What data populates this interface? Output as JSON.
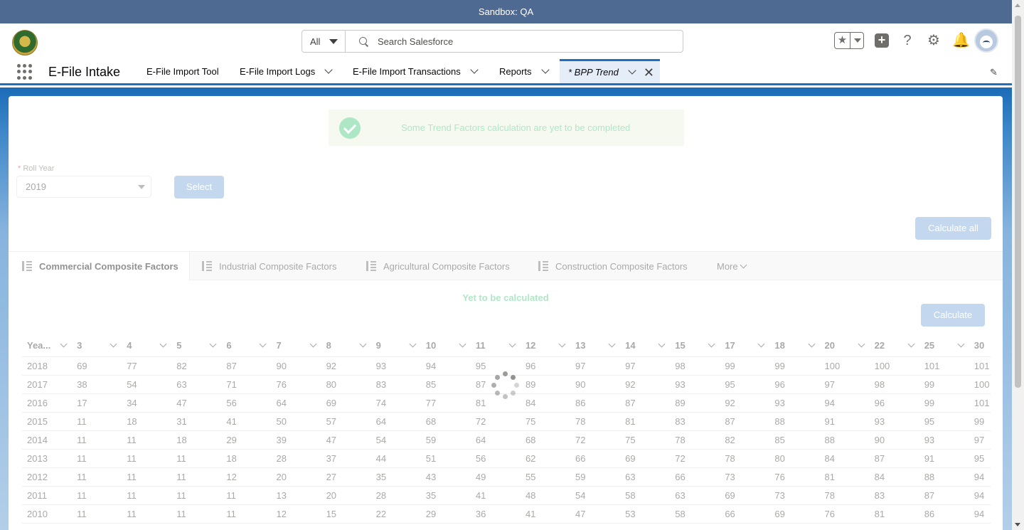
{
  "sandbox": {
    "label": "Sandbox: QA"
  },
  "header": {
    "search_scope": "All",
    "search_placeholder": "Search Salesforce",
    "icons": [
      "favorites-star-icon",
      "add-plus-icon",
      "help-question-icon",
      "setup-gear-icon",
      "notification-bell-icon",
      "user-avatar"
    ]
  },
  "nav": {
    "app_name": "E-File Intake",
    "items": [
      {
        "label": "E-File Import Tool"
      },
      {
        "label": "E-File Import Logs"
      },
      {
        "label": "E-File Import Transactions"
      },
      {
        "label": "Reports"
      }
    ],
    "active_tab": "* BPP Trend"
  },
  "toast": {
    "message": "Some Trend Factors calculation are yet to be completed"
  },
  "form": {
    "roll_year_label": "Roll Year",
    "roll_year_required": "*",
    "roll_year_value": "2019",
    "select_button": "Select",
    "calculate_all_button": "Calculate all"
  },
  "tabs": [
    {
      "label": "Commercial Composite Factors"
    },
    {
      "label": "Industrial Composite Factors"
    },
    {
      "label": "Agricultural Composite Factors"
    },
    {
      "label": "Construction Composite Factors"
    }
  ],
  "more_tab": "More",
  "status_text": "Yet to be calculated",
  "calculate_button": "Calculate",
  "table": {
    "columns": [
      "Yea...",
      "3",
      "4",
      "5",
      "6",
      "7",
      "8",
      "9",
      "10",
      "11",
      "12",
      "13",
      "14",
      "15",
      "17",
      "18",
      "20",
      "22",
      "25",
      "30"
    ],
    "rows": [
      [
        "2018",
        "69",
        "77",
        "82",
        "87",
        "90",
        "92",
        "93",
        "94",
        "95",
        "96",
        "97",
        "97",
        "98",
        "99",
        "99",
        "100",
        "100",
        "101",
        "101"
      ],
      [
        "2017",
        "38",
        "54",
        "63",
        "71",
        "76",
        "80",
        "83",
        "85",
        "87",
        "89",
        "90",
        "92",
        "93",
        "95",
        "96",
        "97",
        "98",
        "99",
        "100"
      ],
      [
        "2016",
        "17",
        "34",
        "47",
        "56",
        "64",
        "69",
        "74",
        "77",
        "81",
        "84",
        "86",
        "87",
        "89",
        "92",
        "93",
        "94",
        "96",
        "99",
        "101"
      ],
      [
        "2015",
        "11",
        "18",
        "31",
        "41",
        "50",
        "57",
        "64",
        "68",
        "72",
        "75",
        "78",
        "81",
        "83",
        "87",
        "88",
        "91",
        "93",
        "95",
        "99"
      ],
      [
        "2014",
        "11",
        "11",
        "18",
        "29",
        "39",
        "47",
        "54",
        "59",
        "64",
        "68",
        "72",
        "75",
        "78",
        "82",
        "85",
        "88",
        "90",
        "93",
        "97"
      ],
      [
        "2013",
        "11",
        "11",
        "11",
        "18",
        "28",
        "37",
        "44",
        "51",
        "56",
        "62",
        "66",
        "69",
        "72",
        "78",
        "80",
        "84",
        "87",
        "91",
        "95"
      ],
      [
        "2012",
        "11",
        "11",
        "11",
        "12",
        "20",
        "27",
        "35",
        "43",
        "49",
        "55",
        "59",
        "63",
        "66",
        "73",
        "76",
        "81",
        "84",
        "88",
        "94"
      ],
      [
        "2011",
        "11",
        "11",
        "11",
        "11",
        "13",
        "20",
        "28",
        "35",
        "41",
        "48",
        "54",
        "58",
        "63",
        "69",
        "73",
        "78",
        "83",
        "87",
        "94"
      ],
      [
        "2010",
        "11",
        "11",
        "11",
        "11",
        "12",
        "15",
        "22",
        "29",
        "36",
        "41",
        "47",
        "53",
        "58",
        "66",
        "69",
        "76",
        "81",
        "86",
        "94"
      ]
    ]
  },
  "colors": {
    "brand": "#1d6fc2",
    "success": "#4bca81",
    "sandbox_bar": "#4f6a92"
  }
}
